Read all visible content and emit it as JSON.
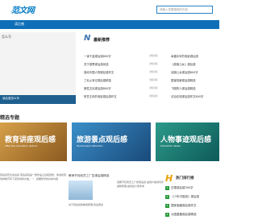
{
  "header": {
    "logo_text": "范文网",
    "logo_sub": "FANWEN.CN",
    "search_placeholder": "请输入您要搜索的内容",
    "nav_item": "读后感"
  },
  "sidebar": {
    "title": "怎么写",
    "banner_text": "读后感怎么写"
  },
  "hot": {
    "title": "最新推荐",
    "left": [
      {
        "t": "一读千金观后感800字",
        "d": "05-16"
      },
      {
        "t": "关于感恩观后感优选",
        "d": "05-16"
      },
      {
        "t": "感动中国人物观后感作文",
        "d": "05-16"
      },
      {
        "t": "三毛从军记观后感精选",
        "d": "05-16"
      },
      {
        "t": "狼性文化观后感800字",
        "d": "05-16"
      },
      {
        "t": "阿甘正传的电影观后感作文",
        "d": "05-16"
      }
    ],
    "right": [
      {
        "t": "幸福手拿的电影观后感"
      },
      {
        "t": "《英雄儿女》观后感"
      },
      {
        "t": "战旗儿女观后感800字"
      },
      {
        "t": "国宝档案观后感精选"
      },
      {
        "t": "飞翔的人观后感精选"
      },
      {
        "t": "法治在线观后感作文800字"
      }
    ]
  },
  "section": {
    "title": "精选专题"
  },
  "banners": [
    {
      "title": "教育讲座观后感",
      "sub": "After the education lecture"
    },
    {
      "title": "旅游景点观后感",
      "sub": "Tourist spot reflection"
    },
    {
      "title": "人物事迹观后感",
      "sub": "Character deeds"
    }
  ],
  "bottom": {
    "left_text": "观后感范文读后感 观后感就是一部作品之后把感想、体会和受到的教育写下来形成的文章。一、把握原作的基本内容",
    "mid_title": "教师节向老员工广告观后感精选",
    "mid_sub": "运费单价同比上涨中",
    "mid_desc": "观看节目老员工广告观后感 由用户提供同步编辑整理,提供给大家参考",
    "mid_desc2": "关于观后感的精选整理,欢迎阅读"
  },
  "ranking": {
    "title": "热门排行榜",
    "items": [
      "白雪观后感300字",
      "《少年中国说》观后感",
      "国家宝藏观后感作文",
      "大国重器观后感精选"
    ]
  },
  "colors": {
    "accent": "#0e6fb8",
    "rank_green": "#2a9a3a"
  }
}
